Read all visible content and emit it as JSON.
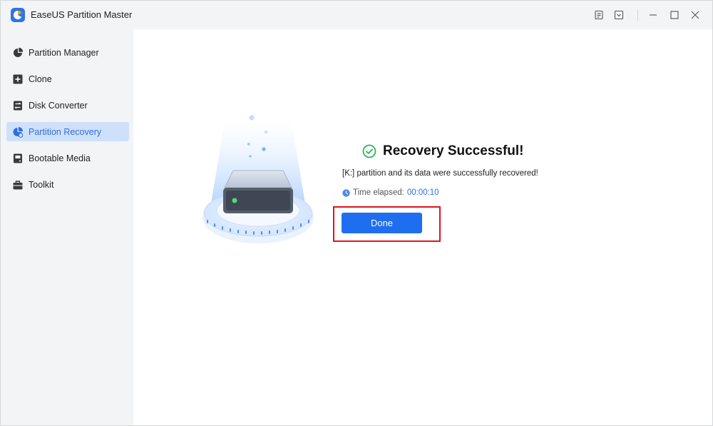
{
  "window": {
    "title": "EaseUS Partition Master",
    "controls": {
      "feedback_icon": "note-icon",
      "menu_icon": "dropdown-menu-icon",
      "minimize_icon": "minimize-icon",
      "maximize_icon": "maximize-icon",
      "close_icon": "close-icon"
    }
  },
  "sidebar": {
    "items": [
      {
        "label": "Partition Manager",
        "icon": "pie-chart-icon",
        "active": false
      },
      {
        "label": "Clone",
        "icon": "clone-icon",
        "active": false
      },
      {
        "label": "Disk Converter",
        "icon": "disk-converter-icon",
        "active": false
      },
      {
        "label": "Partition Recovery",
        "icon": "partition-recovery-icon",
        "active": true
      },
      {
        "label": "Bootable Media",
        "icon": "bootable-media-icon",
        "active": false
      },
      {
        "label": "Toolkit",
        "icon": "toolbox-icon",
        "active": false
      }
    ]
  },
  "result": {
    "title": "Recovery Successful!",
    "message": "[K:] partition and its data were successfully recovered!",
    "elapsed_label": "Time elapsed:",
    "elapsed_value": "00:00:10",
    "done_label": "Done"
  },
  "colors": {
    "accent": "#1f6ef0",
    "success": "#2fb35b",
    "highlight": "#e0141b",
    "active_nav_bg": "#cfe0fb"
  }
}
